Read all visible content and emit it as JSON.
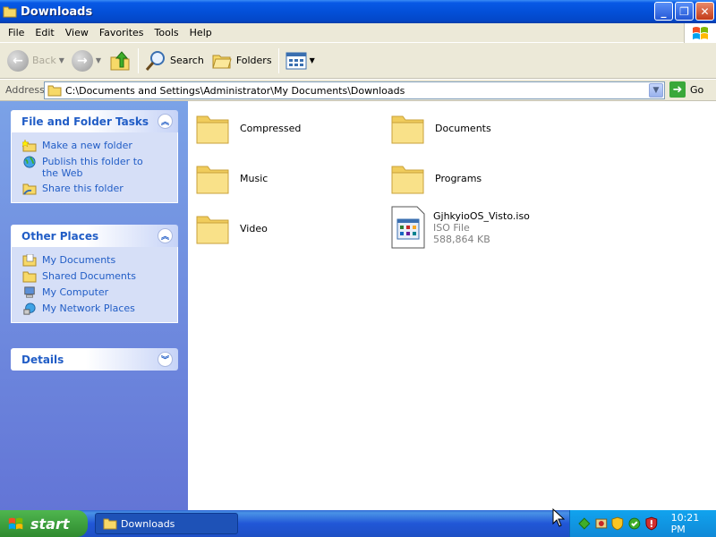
{
  "window": {
    "title": "Downloads"
  },
  "menu": [
    "File",
    "Edit",
    "View",
    "Favorites",
    "Tools",
    "Help"
  ],
  "toolbar": {
    "back": "Back",
    "search": "Search",
    "folders": "Folders"
  },
  "address": {
    "label": "Address",
    "path": "C:\\Documents and Settings\\Administrator\\My Documents\\Downloads",
    "go": "Go"
  },
  "left": {
    "file_tasks": {
      "title": "File and Folder Tasks",
      "items": [
        "Make a new folder",
        "Publish this folder to the Web",
        "Share this folder"
      ]
    },
    "other_places": {
      "title": "Other Places",
      "items": [
        "My Documents",
        "Shared Documents",
        "My Computer",
        "My Network Places"
      ]
    },
    "details": {
      "title": "Details"
    }
  },
  "content": {
    "items": [
      {
        "name": "Compressed"
      },
      {
        "name": "Documents"
      },
      {
        "name": "Music"
      },
      {
        "name": "Programs"
      },
      {
        "name": "Video"
      },
      {
        "name": "GjhkyioOS_Visto.iso",
        "type": "ISO File",
        "size": "588,864 KB"
      }
    ]
  },
  "taskbar": {
    "start": "start",
    "task": "Downloads",
    "clock": "10:21 PM"
  },
  "colors": {
    "titlebar": "#0350d8",
    "pane_link": "#215dc6",
    "folder": "#f7d968"
  }
}
